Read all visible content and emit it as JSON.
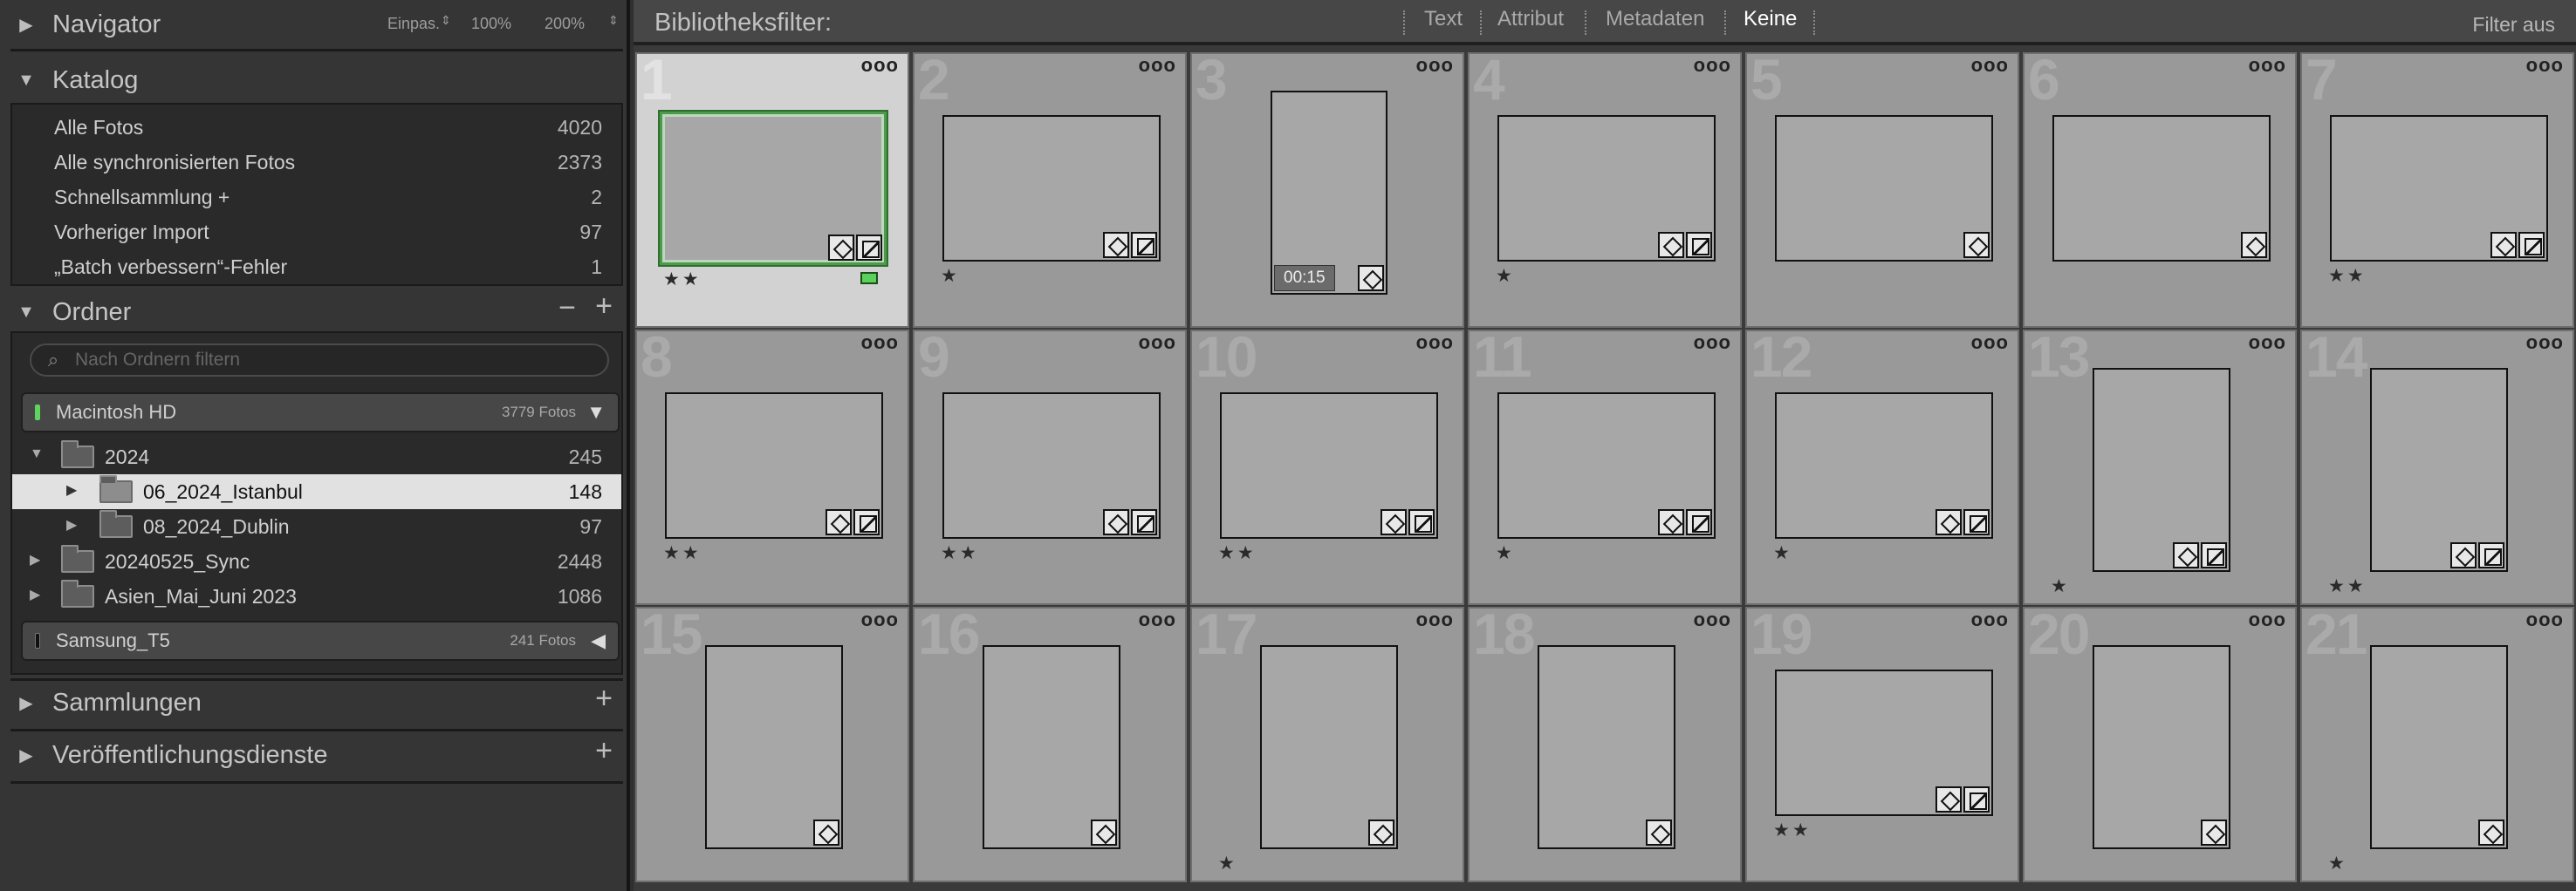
{
  "navigator": {
    "title": "Navigator",
    "zoom_opts": [
      "Einpas.",
      "100%",
      "200%"
    ]
  },
  "catalog": {
    "title": "Katalog",
    "items": [
      {
        "label": "Alle Fotos",
        "count": "4020"
      },
      {
        "label": "Alle synchronisierten Fotos",
        "count": "2373"
      },
      {
        "label": "Schnellsammlung  +",
        "count": "2"
      },
      {
        "label": "Vorheriger Import",
        "count": "97"
      },
      {
        "label": "„Batch verbessern“-Fehler",
        "count": "1"
      }
    ]
  },
  "folders": {
    "title": "Ordner",
    "search_placeholder": "Nach Ordnern filtern",
    "volumes": [
      {
        "name": "Macintosh HD",
        "count": "3779 Fotos",
        "led": "#5fd35f"
      },
      {
        "name": "Samsung_T5",
        "count": "241 Fotos",
        "led": "#101010"
      }
    ],
    "tree": [
      {
        "label": "2024",
        "count": "245"
      },
      {
        "label": "06_2024_Istanbul",
        "count": "148"
      },
      {
        "label": "08_2024_Dublin",
        "count": "97"
      },
      {
        "label": "20240525_Sync",
        "count": "2448"
      },
      {
        "label": "Asien_Mai_Juni 2023",
        "count": "1086"
      }
    ]
  },
  "collections": {
    "title": "Sammlungen"
  },
  "publish": {
    "title": "Veröffentlichungsdienste"
  },
  "filterbar": {
    "title": "Bibliotheksfilter:",
    "tabs": [
      "Text",
      "Attribut",
      "Metadaten",
      "Keine"
    ],
    "active_tab": "Keine",
    "filter_off": "Filter aus"
  },
  "grid": {
    "cells": [
      {
        "n": "1",
        "stars": "★★",
        "orient": "land",
        "badges": [
          "tag",
          "dev"
        ],
        "selected": true,
        "flag": true
      },
      {
        "n": "2",
        "stars": "★",
        "orient": "land",
        "badges": [
          "tag",
          "dev"
        ]
      },
      {
        "n": "3",
        "stars": "",
        "orient": "video",
        "badges": [
          "tag"
        ],
        "duration": "00:15"
      },
      {
        "n": "4",
        "stars": "★",
        "orient": "land",
        "badges": [
          "tag",
          "dev"
        ]
      },
      {
        "n": "5",
        "stars": "",
        "orient": "land",
        "badges": [
          "tag"
        ]
      },
      {
        "n": "6",
        "stars": "",
        "orient": "land",
        "badges": [
          "tag"
        ]
      },
      {
        "n": "7",
        "stars": "★★",
        "orient": "land",
        "badges": [
          "tag",
          "dev"
        ]
      },
      {
        "n": "8",
        "stars": "★★",
        "orient": "land",
        "badges": [
          "tag",
          "dev"
        ]
      },
      {
        "n": "9",
        "stars": "★★",
        "orient": "land",
        "badges": [
          "tag",
          "dev"
        ]
      },
      {
        "n": "10",
        "stars": "★★",
        "orient": "land",
        "badges": [
          "tag",
          "dev"
        ]
      },
      {
        "n": "11",
        "stars": "★",
        "orient": "land",
        "badges": [
          "tag",
          "dev"
        ]
      },
      {
        "n": "12",
        "stars": "★",
        "orient": "land",
        "badges": [
          "tag",
          "dev"
        ]
      },
      {
        "n": "13",
        "stars": "★",
        "orient": "port",
        "badges": [
          "tag",
          "dev"
        ]
      },
      {
        "n": "14",
        "stars": "★★",
        "orient": "port",
        "badges": [
          "tag",
          "dev"
        ]
      },
      {
        "n": "15",
        "stars": "",
        "orient": "port",
        "badges": [
          "tag"
        ]
      },
      {
        "n": "16",
        "stars": "",
        "orient": "port",
        "badges": [
          "tag"
        ]
      },
      {
        "n": "17",
        "stars": "★",
        "orient": "port",
        "badges": [
          "tag"
        ]
      },
      {
        "n": "18",
        "stars": "",
        "orient": "port",
        "badges": [
          "tag"
        ]
      },
      {
        "n": "19",
        "stars": "★★",
        "orient": "land",
        "badges": [
          "tag",
          "dev"
        ]
      },
      {
        "n": "20",
        "stars": "",
        "orient": "port",
        "badges": [
          "tag"
        ]
      },
      {
        "n": "21",
        "stars": "★",
        "orient": "port",
        "badges": [
          "tag"
        ]
      }
    ],
    "more_label": "ooo"
  }
}
